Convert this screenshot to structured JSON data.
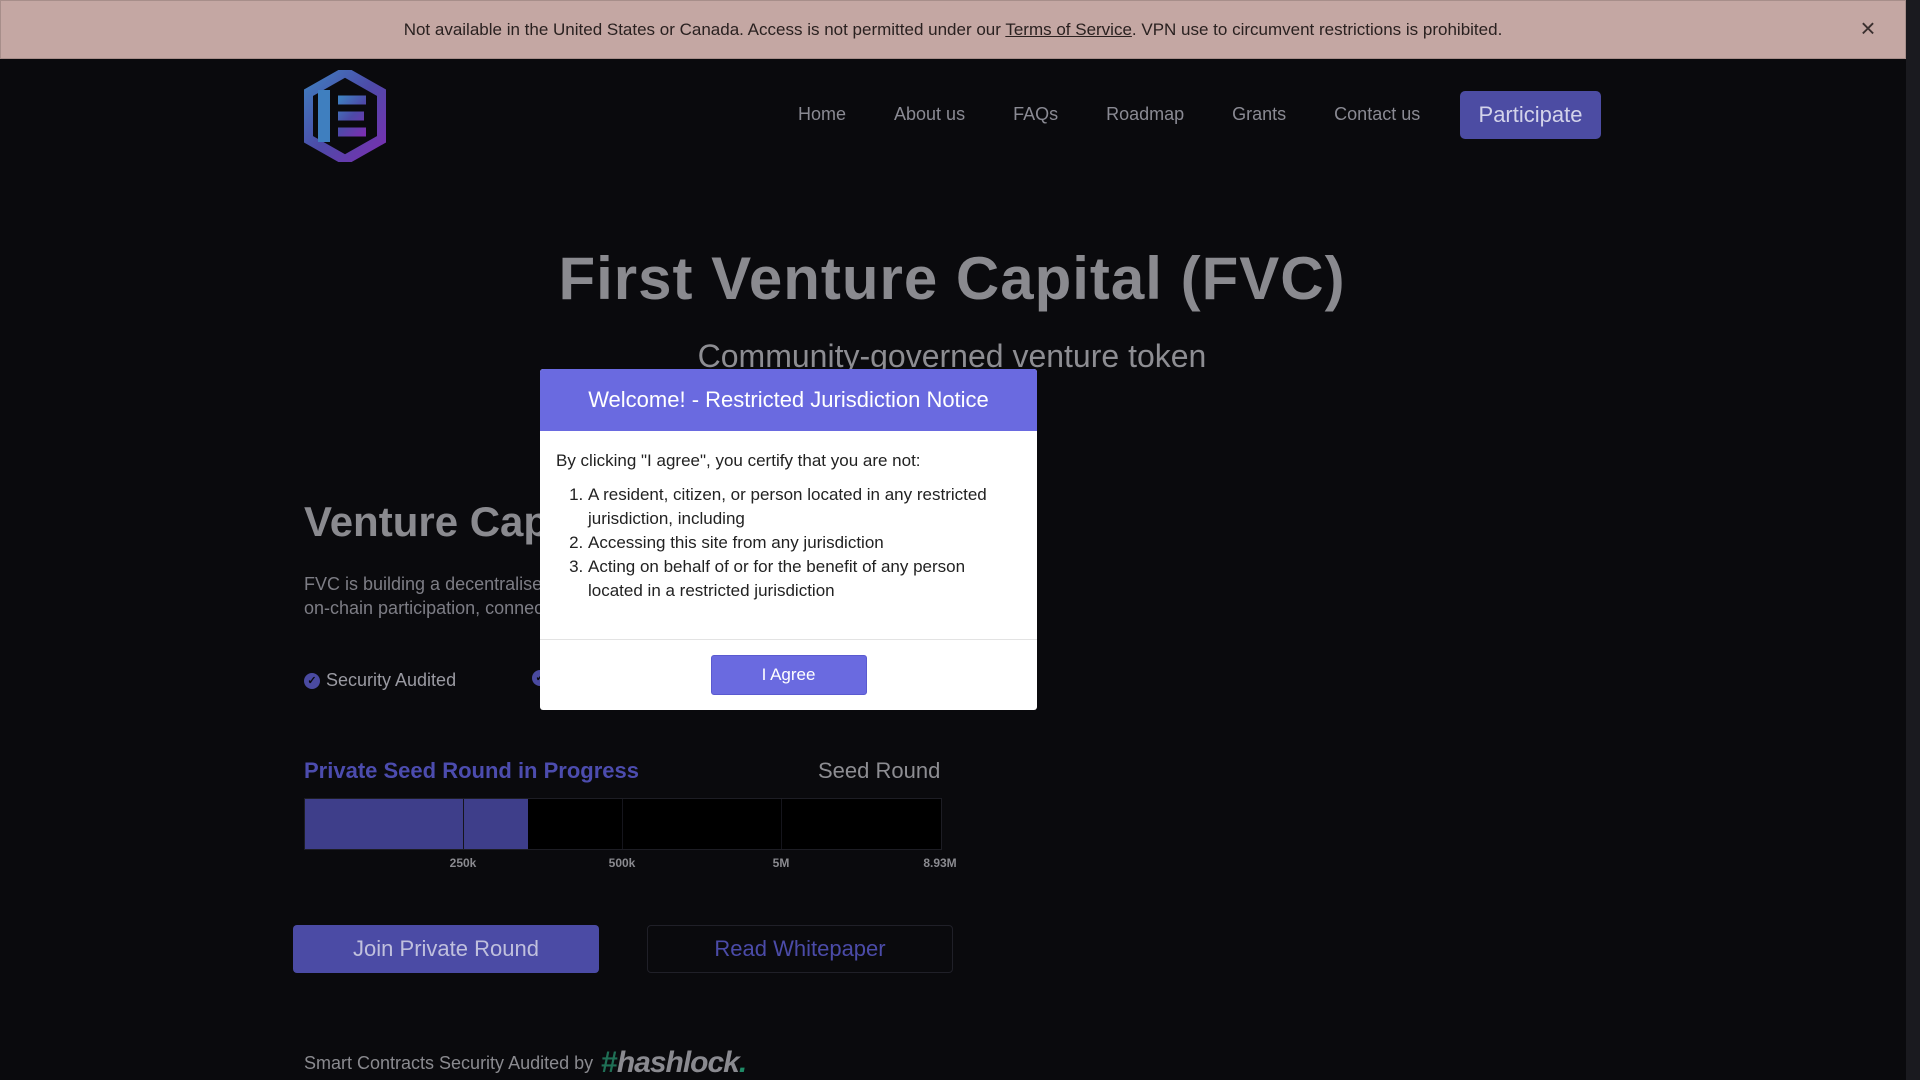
{
  "banner": {
    "text_before": "Not available in the United States or Canada. Access is not permitted under our ",
    "tos_link": "Terms of Service",
    "text_after": ". VPN use to circumvent restrictions is prohibited.",
    "close_icon": "×"
  },
  "nav": {
    "items": [
      "Home",
      "About us",
      "FAQs",
      "Roadmap",
      "Grants",
      "Contact us"
    ],
    "cta": "Participate"
  },
  "hero": {
    "title": "First Venture Capital (FVC)",
    "subtitle": "Community-governed venture token"
  },
  "section": {
    "title": "Venture Cap",
    "desc_line1": "FVC is building a decentralise",
    "desc_line2": "on-chain participation, connec",
    "badge1": "Security Audited"
  },
  "progress": {
    "title": "Private Seed Round in Progress",
    "label_right": "Seed Round",
    "fill_fraction": 0.35,
    "ticks": [
      "250k",
      "500k",
      "5M",
      "8.93M"
    ]
  },
  "buttons": {
    "join": "Join Private Round",
    "read": "Read Whitepaper"
  },
  "audit": {
    "text": "Smart Contracts Security Audited by",
    "brand": "hashlock",
    "brand_hash": "#",
    "brand_dot": "."
  },
  "modal": {
    "title": "Welcome! - Restricted Jurisdiction Notice",
    "intro": "By clicking \"I agree\", you certify that you are not:",
    "items": [
      "A resident, citizen, or person located in any restricted jurisdiction, including",
      "Accessing this site from any jurisdiction",
      "Acting on behalf of or for the benefit of any person located in a restricted jurisdiction"
    ],
    "agree": "I Agree"
  },
  "colors": {
    "accent": "#6a6ae0",
    "banner_bg": "#c4a7a3",
    "page_bg": "#0a0a0d"
  }
}
